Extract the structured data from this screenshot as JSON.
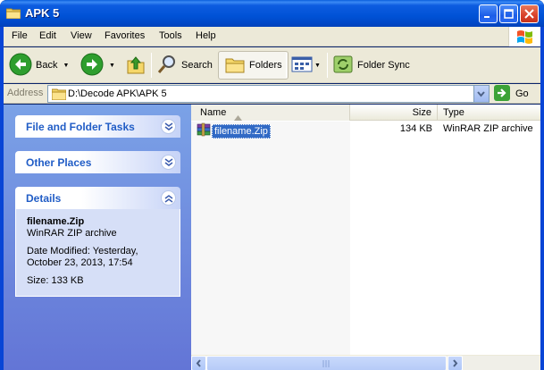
{
  "window": {
    "title": "APK 5"
  },
  "menu": [
    "File",
    "Edit",
    "View",
    "Favorites",
    "Tools",
    "Help"
  ],
  "toolbar": {
    "back_label": "Back",
    "search_label": "Search",
    "folders_label": "Folders",
    "folder_sync_label": "Folder Sync"
  },
  "address": {
    "label": "Address",
    "path": "D:\\Decode APK\\APK 5",
    "go_label": "Go"
  },
  "taskpane": {
    "file_folder_tasks": "File and Folder Tasks",
    "other_places": "Other Places",
    "details": {
      "title": "Details",
      "name": "filename.Zip",
      "type": "WinRAR ZIP archive",
      "date_modified": "Date Modified: Yesterday, October 23, 2013, 17:54",
      "size": "Size: 133 KB"
    }
  },
  "filelist": {
    "columns": {
      "name": "Name",
      "size": "Size",
      "type": "Type"
    },
    "rows": [
      {
        "name": "filename.Zip",
        "size": "134 KB",
        "type": "WinRAR ZIP archive"
      }
    ]
  },
  "colors": {
    "titlebar": "#0054e3",
    "taskpane": "#7ba2e7",
    "selection": "#316ac5"
  }
}
